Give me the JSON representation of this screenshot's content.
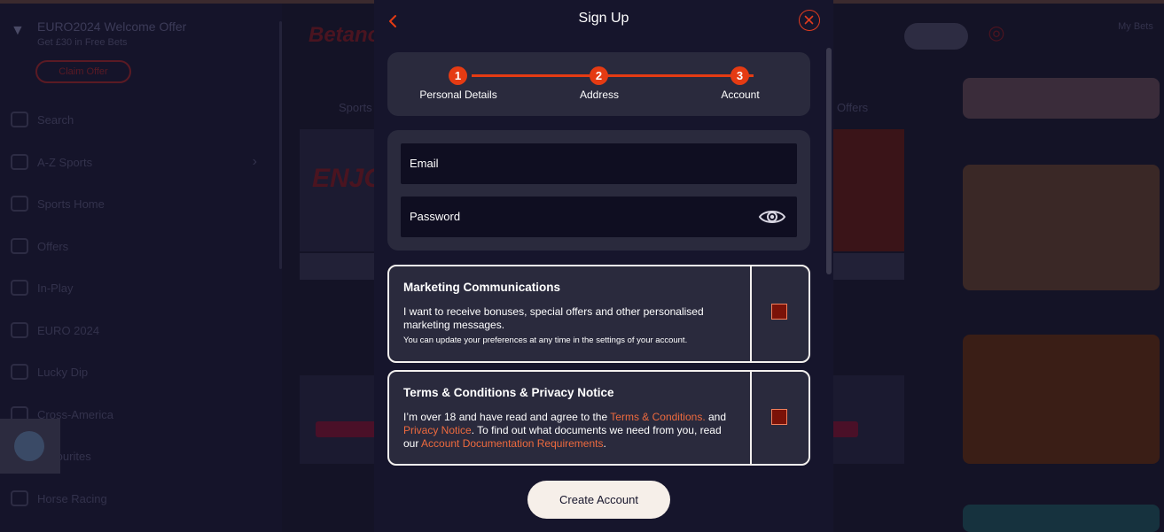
{
  "background": {
    "promo": {
      "title": "EURO2024 Welcome Offer",
      "subtitle": "Get £30 in Free Bets",
      "claim_label": "Claim Offer"
    },
    "nav_items": [
      {
        "label": "Search",
        "icon": "search-icon"
      },
      {
        "label": "A-Z Sports",
        "icon": "list-icon"
      },
      {
        "label": "Sports Home",
        "icon": "trophy-icon"
      },
      {
        "label": "Offers",
        "icon": "gift-icon"
      },
      {
        "label": "In-Play",
        "icon": "play-icon"
      },
      {
        "label": "EURO 2024",
        "icon": "football-icon"
      },
      {
        "label": "Lucky Dip",
        "icon": "dice-icon"
      },
      {
        "label": "Cross-America",
        "icon": "globe-icon"
      },
      {
        "label": "Favourites",
        "icon": "star-icon"
      },
      {
        "label": "Horse Racing",
        "icon": "horse-icon"
      }
    ],
    "site_title": "Betano",
    "sports_tab": "Sports",
    "offers_tab": "Offers",
    "banner_text": "ENJOY ANY S",
    "right_tab_mybets": "My Bets"
  },
  "modal": {
    "title": "Sign Up",
    "steps": [
      {
        "number": "1",
        "label": "Personal Details"
      },
      {
        "number": "2",
        "label": "Address"
      },
      {
        "number": "3",
        "label": "Account"
      }
    ],
    "email_label": "Email",
    "password_label": "Password",
    "marketing": {
      "title": "Marketing Communications",
      "body": "I want to receive bonuses, special offers and other personalised marketing messages.",
      "note": "You can update your preferences at any time in the settings of your account.",
      "checked": false
    },
    "terms": {
      "title": "Terms & Conditions & Privacy Notice",
      "text_1": "I’m over 18 and have read and agree to the ",
      "link_terms": "Terms & Conditions.",
      "text_2": " and ",
      "link_privacy": "Privacy Notice",
      "text_3": ". To find out what documents we need from you, read our ",
      "link_docs": "Account Documentation Requirements",
      "text_4": ".",
      "checked": false
    },
    "create_label": "Create Account"
  },
  "colors": {
    "accent": "#e53b13",
    "link": "#ee6a3e",
    "modal_bg": "#16152c",
    "panel": "#2a2a3d",
    "field": "#0f0e21"
  }
}
